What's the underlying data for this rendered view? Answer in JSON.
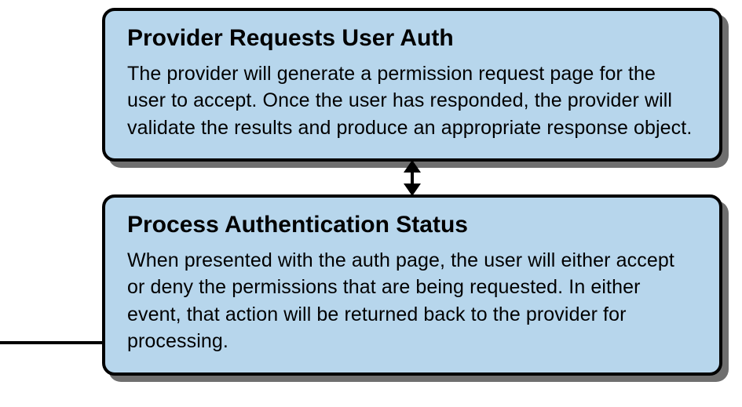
{
  "diagram": {
    "nodes": [
      {
        "id": "provider-requests-user-auth",
        "title": "Provider Requests User Auth",
        "body": "The provider will generate a permission request page for the user to accept. Once the user has responded, the provider will validate the results and produce an appropriate response object."
      },
      {
        "id": "process-authentication-status",
        "title": "Process Authentication Status",
        "body": "When presented with the auth page, the user will either accept or deny the permissions that are being requested. In either event, that action will be returned back to the provider for processing."
      }
    ],
    "connector": {
      "type": "bidirectional-vertical"
    },
    "colors": {
      "node_fill": "#b7d6ec",
      "node_border": "#000000",
      "shadow": "#6f6f6f"
    }
  }
}
